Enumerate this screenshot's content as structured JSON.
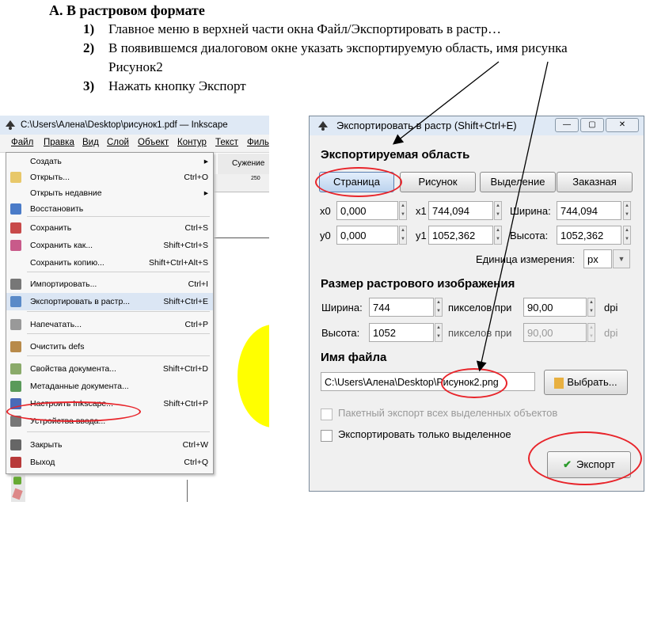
{
  "doc": {
    "heading": "A.  В растровом формате",
    "steps": [
      {
        "num": "1)",
        "text": "Главное меню в верхней части окна Файл/Экспортировать в растр…"
      },
      {
        "num": "2)",
        "text": "В появившемся диалоговом окне указать экспортируемую область, имя рисунка"
      },
      {
        "num": "",
        "text": "Рисунок2"
      },
      {
        "num": "3)",
        "text": "Нажать кнопку Экспорт"
      }
    ]
  },
  "left_window": {
    "title": "C:\\Users\\Алена\\Desktop\\рисунок1.pdf — Inkscape",
    "menubar": [
      "Файл",
      "Правка",
      "Вид",
      "Слой",
      "Объект",
      "Контур",
      "Текст",
      "Филь"
    ],
    "toolbar_label": "Сужение",
    "ruler_mark": "250",
    "menu_items": [
      {
        "label": "Создать",
        "shortcut": "▸",
        "icon": ""
      },
      {
        "label": "Открыть...",
        "shortcut": "Ctrl+O",
        "icon": "folder-icon"
      },
      {
        "label": "Открыть недавние",
        "shortcut": "▸",
        "icon": ""
      },
      {
        "label": "Восстановить",
        "shortcut": "",
        "icon": "revert-icon"
      },
      {
        "label": "Сохранить",
        "shortcut": "Ctrl+S",
        "icon": "save-icon"
      },
      {
        "label": "Сохранить как...",
        "shortcut": "Shift+Ctrl+S",
        "icon": "save-as-icon"
      },
      {
        "label": "Сохранить копию...",
        "shortcut": "Shift+Ctrl+Alt+S",
        "icon": ""
      },
      {
        "label": "Импортировать...",
        "shortcut": "Ctrl+I",
        "icon": "import-icon"
      },
      {
        "label": "Экспортировать в растр...",
        "shortcut": "Shift+Ctrl+E",
        "icon": "export-icon"
      },
      {
        "label": "Напечатать...",
        "shortcut": "Ctrl+P",
        "icon": "print-icon"
      },
      {
        "label": "Очистить defs",
        "shortcut": "",
        "icon": "clean-icon"
      },
      {
        "label": "Свойства документа...",
        "shortcut": "Shift+Ctrl+D",
        "icon": "doc-props-icon"
      },
      {
        "label": "Метаданные документа...",
        "shortcut": "",
        "icon": "metadata-icon"
      },
      {
        "label": "Настроить Inkscape...",
        "shortcut": "Shift+Ctrl+P",
        "icon": "prefs-icon"
      },
      {
        "label": "Устройства ввода...",
        "shortcut": "",
        "icon": "input-devices-icon"
      },
      {
        "label": "Закрыть",
        "shortcut": "Ctrl+W",
        "icon": "close-icon"
      },
      {
        "label": "Выход",
        "shortcut": "Ctrl+Q",
        "icon": "quit-icon"
      }
    ]
  },
  "dialog": {
    "title": "Экспортировать в растр (Shift+Ctrl+E)",
    "area_heading": "Экспортируемая область",
    "area_tabs": [
      "Страница",
      "Рисунок",
      "Выделение",
      "Заказная"
    ],
    "x0_label": "x0",
    "x0": "0,000",
    "x1_label": "x1",
    "x1": "744,094",
    "width_label": "Ширина:",
    "width": "744,094",
    "y0_label": "y0",
    "y0": "0,000",
    "y1_label": "y1",
    "y1": "1052,362",
    "height_label": "Высота:",
    "height": "1052,362",
    "units_label": "Единица измерения:",
    "units": "px",
    "bitmap_heading": "Размер растрового изображения",
    "bmp_width_label": "Ширина:",
    "bmp_width": "744",
    "bmp_height_label": "Высота:",
    "bmp_height": "1052",
    "pixels_at": "пикселов при",
    "dpi_x": "90,00",
    "dpi_y": "90,00",
    "dpi": "dpi",
    "filename_heading": "Имя файла",
    "filename": "C:\\Users\\Алена\\Desktop\\Рисунок2.png",
    "browse_label": "Выбрать...",
    "batch_label": "Пакетный экспорт всех выделенных объектов",
    "selected_only_label": "Экспортировать только выделенное",
    "export_label": "Экспорт"
  },
  "colors": {
    "highlight": "#e8242a",
    "yellow": "#ffff00"
  }
}
